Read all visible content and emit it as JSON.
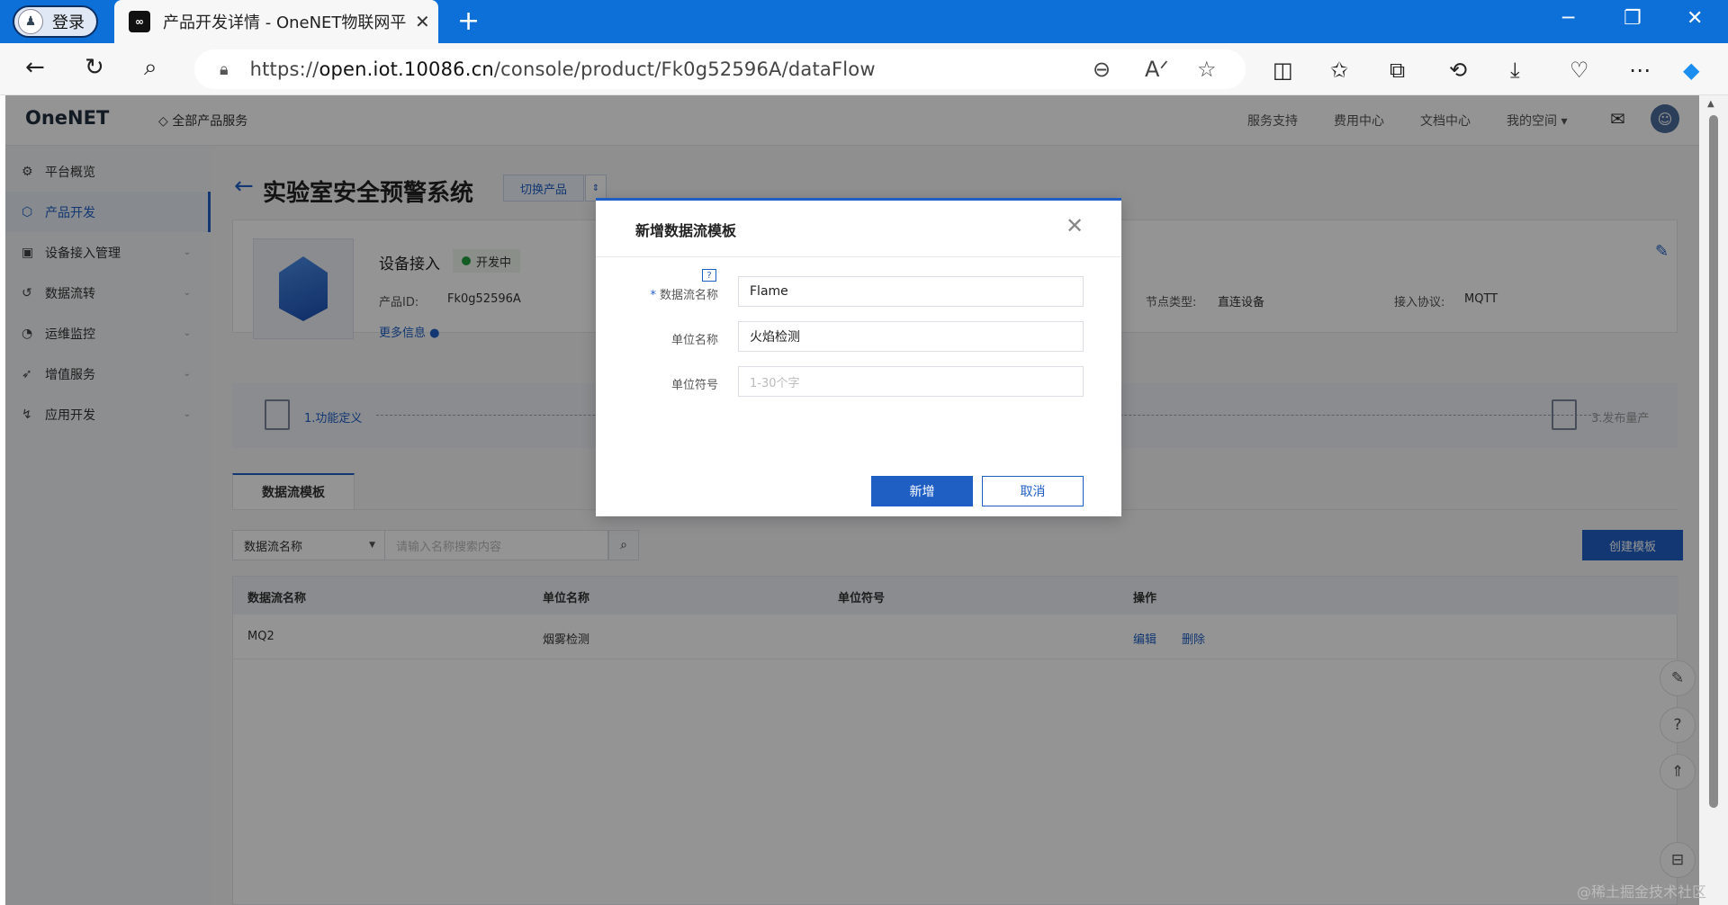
{
  "browser": {
    "profile_label": "登录",
    "tab_title": "产品开发详情 - OneNET物联网平",
    "tab_close": "✕",
    "url_scheme": "https://",
    "url_host": "open.iot.10086.cn",
    "url_path": "/console/product/Fk0g52596A/dataFlow"
  },
  "header": {
    "logo": "OneNET",
    "all_products": "全部产品服务",
    "links": [
      "服务支持",
      "费用中心",
      "文档中心",
      "我的空间 ▾"
    ]
  },
  "sidebar": {
    "items": [
      {
        "label": "平台概览",
        "icon": "dashboard-icon"
      },
      {
        "label": "产品开发",
        "icon": "cube-icon"
      },
      {
        "label": "设备接入管理",
        "icon": "device-icon"
      },
      {
        "label": "数据流转",
        "icon": "flow-icon"
      },
      {
        "label": "运维监控",
        "icon": "monitor-icon"
      },
      {
        "label": "增值服务",
        "icon": "rocket-icon"
      },
      {
        "label": "应用开发",
        "icon": "app-icon"
      }
    ]
  },
  "product": {
    "title": "实验室安全预警系统",
    "switch_label": "切换产品",
    "name": "设备接入",
    "status": "开发中",
    "id_label": "产品ID:",
    "id_value": "Fk0g52596A",
    "node_label": "节点类型:",
    "node_value": "直连设备",
    "protocol_label": "接入协议:",
    "protocol_value": "MQTT",
    "more_info": "更多信息"
  },
  "steps": {
    "step1": "1.功能定义",
    "step3": "3.发布量产"
  },
  "tabs": {
    "active": "数据流模板"
  },
  "filter": {
    "select_value": "数据流名称",
    "search_placeholder": "请输入名称搜索内容",
    "create_label": "创建模板"
  },
  "table": {
    "headers": [
      "数据流名称",
      "单位名称",
      "单位符号",
      "操作"
    ],
    "rows": [
      {
        "name": "MQ2",
        "unit": "烟雾检测",
        "symbol": "",
        "edit": "编辑",
        "delete": "删除"
      }
    ]
  },
  "modal": {
    "title": "新增数据流模板",
    "fields": [
      {
        "label": "数据流名称",
        "required": "*",
        "value": "Flame",
        "placeholder": ""
      },
      {
        "label": "单位名称",
        "required": "",
        "value": "火焰检测",
        "placeholder": ""
      },
      {
        "label": "单位符号",
        "required": "",
        "value": "",
        "placeholder": "1-30个字"
      }
    ],
    "confirm": "新增",
    "cancel": "取消"
  },
  "watermark": "@稀土掘金技术社区",
  "colors": {
    "accent": "#1f5fc4",
    "browser": "#0d6fd8",
    "status_green": "#22a040"
  }
}
